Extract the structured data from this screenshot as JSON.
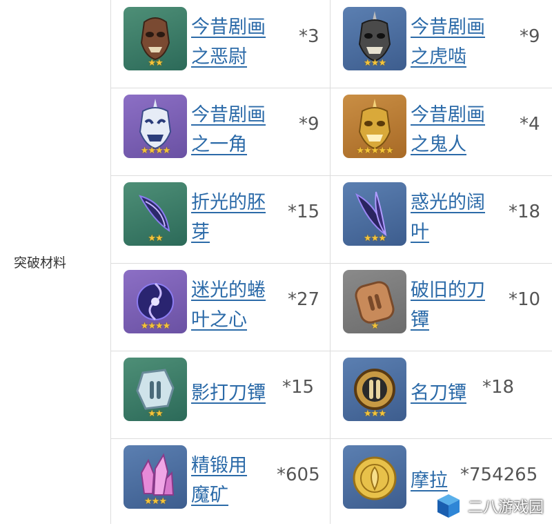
{
  "category_label": "突破材料",
  "items": [
    {
      "name_line1": "今昔剧画",
      "name_line2": "之恶尉",
      "count": "*3",
      "stars": "★★",
      "rarity": "g2",
      "icon": "mask-brown-icon"
    },
    {
      "name_line1": "今昔剧画",
      "name_line2": "之虎啮",
      "count": "*9",
      "stars": "★★★",
      "rarity": "b3",
      "icon": "mask-dark-horned-icon"
    },
    {
      "name_line1": "今昔剧画",
      "name_line2": "之一角",
      "count": "*9",
      "stars": "★★★★",
      "rarity": "p4",
      "icon": "mask-white-horned-icon"
    },
    {
      "name_line1": "今昔剧画",
      "name_line2": "之鬼人",
      "count": "*4",
      "stars": "★★★★★",
      "rarity": "o5",
      "icon": "mask-gold-horned-icon"
    },
    {
      "name_line1": "折光的胚",
      "name_line2": "芽",
      "count": "*15",
      "stars": "★★",
      "rarity": "g2",
      "icon": "crystal-sprout-icon"
    },
    {
      "name_line1": "惑光的阔",
      "name_line2": "叶",
      "count": "*18",
      "stars": "★★★",
      "rarity": "b3",
      "icon": "crystal-leaf-icon"
    },
    {
      "name_line1": "迷光的蜷",
      "name_line2": "叶之心",
      "count": "*27",
      "stars": "★★★★",
      "rarity": "p4",
      "icon": "crystal-heart-icon"
    },
    {
      "name_line1": "破旧的刀",
      "name_line2": "镡",
      "count": "*10",
      "stars": "★",
      "rarity": "gr1",
      "icon": "old-tsuba-icon"
    },
    {
      "name_line1": "影打刀镡",
      "name_line2": "",
      "count": "*15",
      "stars": "★★",
      "rarity": "g2",
      "icon": "silver-tsuba-icon"
    },
    {
      "name_line1": "名刀镡",
      "name_line2": "",
      "count": "*18",
      "stars": "★★★",
      "rarity": "b3",
      "icon": "gold-tsuba-icon"
    },
    {
      "name_line1": "精锻用",
      "name_line2": "魔矿",
      "count": "*605",
      "stars": "★★★",
      "rarity": "b3",
      "icon": "mystic-ore-icon"
    },
    {
      "name_line1": "摩拉",
      "name_line2": "",
      "count": "*754265",
      "stars": "",
      "rarity": "b3",
      "icon": "mora-coin-icon"
    }
  ],
  "watermark": "二八游戏园"
}
